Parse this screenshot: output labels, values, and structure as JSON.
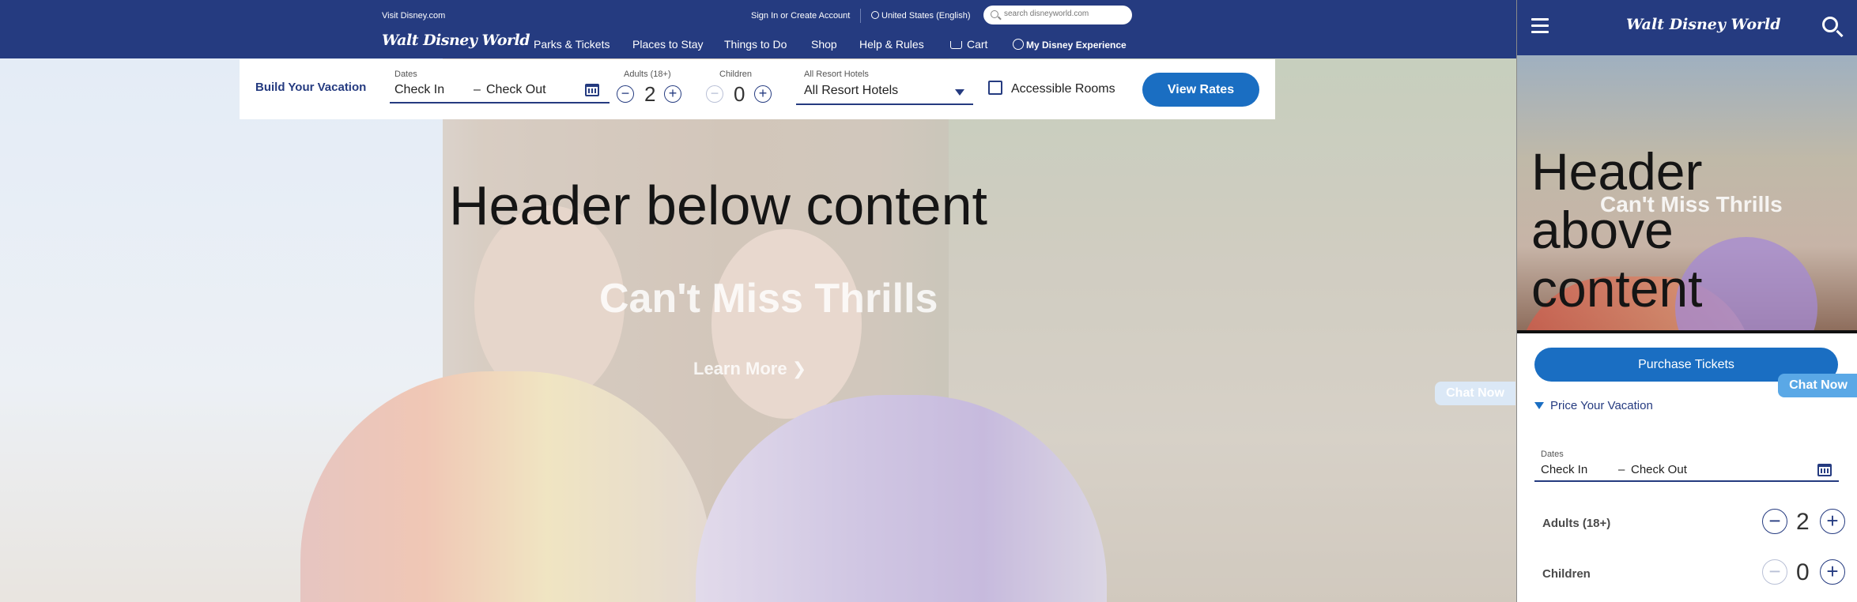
{
  "desktop": {
    "header": {
      "visit_link": "Visit Disney.com",
      "sign_in": "Sign In or Create Account",
      "region": "United States (English)",
      "search_placeholder": "search disneyworld.com",
      "logo": "Walt Disney World",
      "nav": [
        "Parks & Tickets",
        "Places to Stay",
        "Things to Do",
        "Shop",
        "Help & Rules",
        "Cart",
        "My Disney Experience"
      ]
    },
    "booking": {
      "title": "Build Your Vacation",
      "dates_label": "Dates",
      "check_in": "Check In",
      "dash": "–",
      "check_out": "Check Out",
      "adults_label": "Adults (18+)",
      "adults_value": "2",
      "children_label": "Children",
      "children_value": "0",
      "hotels_label": "All Resort Hotels",
      "hotels_value": "All Resort Hotels",
      "accessible_label": "Accessible Rooms",
      "view_rates": "View Rates"
    },
    "hero": {
      "heading": "Header below content",
      "title": "Can't Miss Thrills",
      "cta": "Learn More"
    },
    "chat": "Chat Now"
  },
  "mobile": {
    "logo": "Walt Disney World",
    "heading": "Header above content",
    "hero_title": "Can't Miss Thrills",
    "purchase": "Purchase Tickets",
    "price_toggle": "Price Your Vacation",
    "dates_label": "Dates",
    "check_in": "Check In",
    "dash": "–",
    "check_out": "Check Out",
    "adults_label": "Adults (18+)",
    "adults_value": "2",
    "children_label": "Children",
    "children_value": "0",
    "chat": "Chat Now"
  },
  "colors": {
    "brand_navy": "#253b80",
    "cta_blue": "#1a6ec2"
  }
}
